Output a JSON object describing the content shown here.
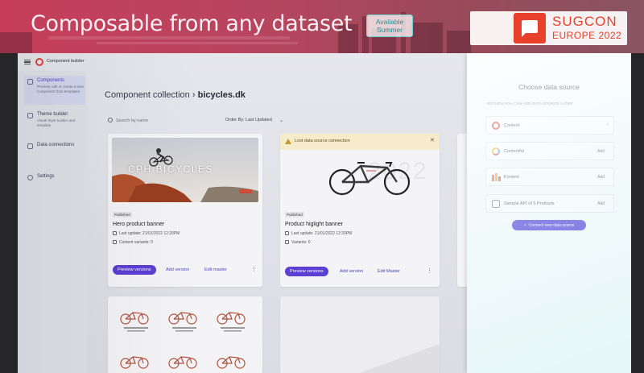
{
  "slide": {
    "title": "Composable from any dataset",
    "badge_line1": "Available",
    "badge_line2": "Summer",
    "logo_name": "SUGCON",
    "logo_sub": "EUROPE 2022"
  },
  "app": {
    "name": "Component builder"
  },
  "nav": {
    "items": [
      {
        "label": "Components",
        "desc": "Preview, edit or create a new component from templates",
        "icon": "puzzle-icon"
      },
      {
        "label": "Theme builder",
        "desc": "Visual Style builder and template",
        "icon": "palette-icon"
      },
      {
        "label": "Data connections",
        "desc": "",
        "icon": "database-icon"
      },
      {
        "label": "Settings",
        "desc": "",
        "icon": "gear-icon"
      }
    ]
  },
  "main": {
    "breadcrumb_root": "Component collection",
    "breadcrumb_sep": "›",
    "breadcrumb_current": "bicycles.dk",
    "search_placeholder": "Search by name",
    "order_label": "Order By: Last Updated",
    "cards": [
      {
        "hero_text": "CPH BICYCLES",
        "tag": "Published",
        "title": "Hero product banner",
        "updated": "Last update: 21/01/2022 12:20PM",
        "variants": "Content variants: 0",
        "primary": "Preview versions",
        "add": "Add version",
        "edit": "Edit master"
      },
      {
        "warning": "Lost data source connection",
        "watermark": "2022",
        "tag": "Published",
        "title": "Product higlight banner",
        "updated": "Last update: 21/01/2022 12:20PM",
        "variants": "Variants: 0",
        "primary": "Preview versions",
        "add": "Add version",
        "edit": "Edit Master"
      }
    ]
  },
  "panel": {
    "title": "Choose data source",
    "note": "RETURN YOU CAN ADD DATA SOURCE LATER",
    "sources": [
      {
        "name": "Content",
        "action": "›",
        "color": "#e0423a"
      },
      {
        "name": "Contentful",
        "action": "Add",
        "color": "#f5b82e"
      },
      {
        "name": "Kontent",
        "action": "Add",
        "color": "#f05a28"
      },
      {
        "name": "Sample API of 5 Products",
        "action": "Add",
        "color": "#666666"
      }
    ],
    "connect_label": "Connect new data source",
    "connect_icon": "+"
  },
  "colors": {
    "primary": "#5a3fd3",
    "connect": "#3a20d8",
    "banner": "#c63e5c",
    "sugcon": "#e8402b"
  }
}
